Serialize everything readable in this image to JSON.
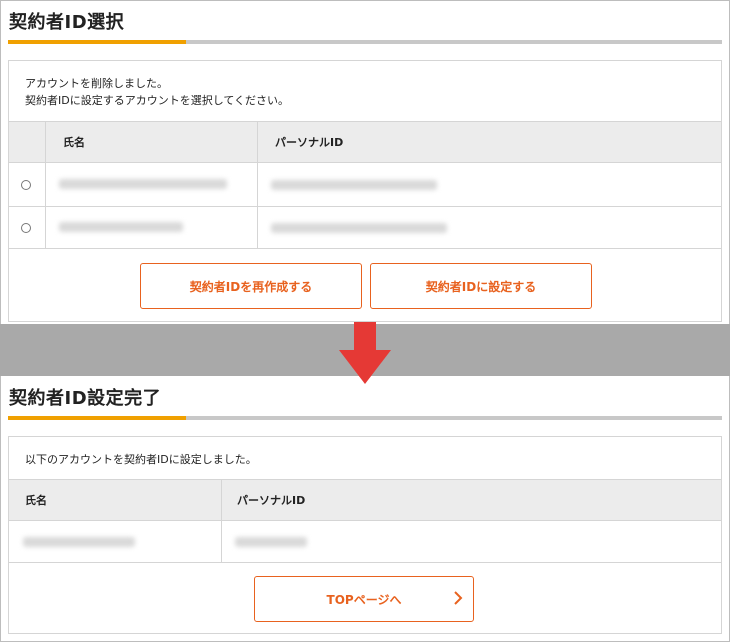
{
  "colors": {
    "accent": "#e8621f",
    "arrow": "#e53935",
    "accent_rule": "#f0a000"
  },
  "section1": {
    "title": "契約者ID選択",
    "message_line1": "アカウントを削除しました。",
    "message_line2": "契約者IDに設定するアカウントを選択してください。",
    "table": {
      "col_name": "氏名",
      "col_personal_id": "パーソナルID",
      "rows": [
        {
          "selected": false
        },
        {
          "selected": false
        }
      ]
    },
    "buttons": {
      "recreate": "契約者IDを再作成する",
      "set": "契約者IDに設定する"
    }
  },
  "transition_icon": "down-arrow-icon",
  "section2": {
    "title": "契約者ID設定完了",
    "message": "以下のアカウントを契約者IDに設定しました。",
    "table": {
      "col_name": "氏名",
      "col_personal_id": "パーソナルID"
    },
    "top_button": "TOPページへ",
    "top_button_icon": "chevron-right-icon"
  }
}
